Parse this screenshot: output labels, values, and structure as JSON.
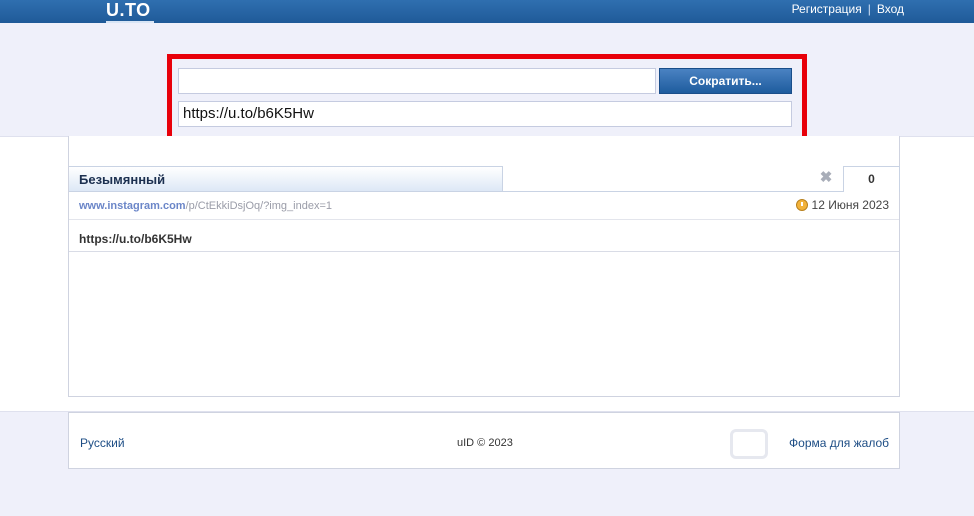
{
  "header": {
    "logo": "U.TO",
    "register_label": "Регистрация",
    "separator": "|",
    "login_label": "Вход"
  },
  "shortener": {
    "input_value": "",
    "button_label": "Сократить...",
    "result": "https://u.to/b6K5Hw"
  },
  "link_card": {
    "title": "Безымянный",
    "counter": "0",
    "source_domain": "www.instagram.com",
    "source_path": "/p/CtEkkiDsjOq/?img_index=1",
    "date": "12 Июня 2023",
    "short_url": "https://u.to/b6K5Hw"
  },
  "footer": {
    "language": "Русский",
    "copyright": "uID © 2023",
    "complaint": "Форма для жалоб"
  },
  "colors": {
    "highlight_border": "#e8000a",
    "header_bg": "#2f6fb0",
    "button_bg": "#1e5c9e",
    "page_bg": "#eff0fa"
  }
}
